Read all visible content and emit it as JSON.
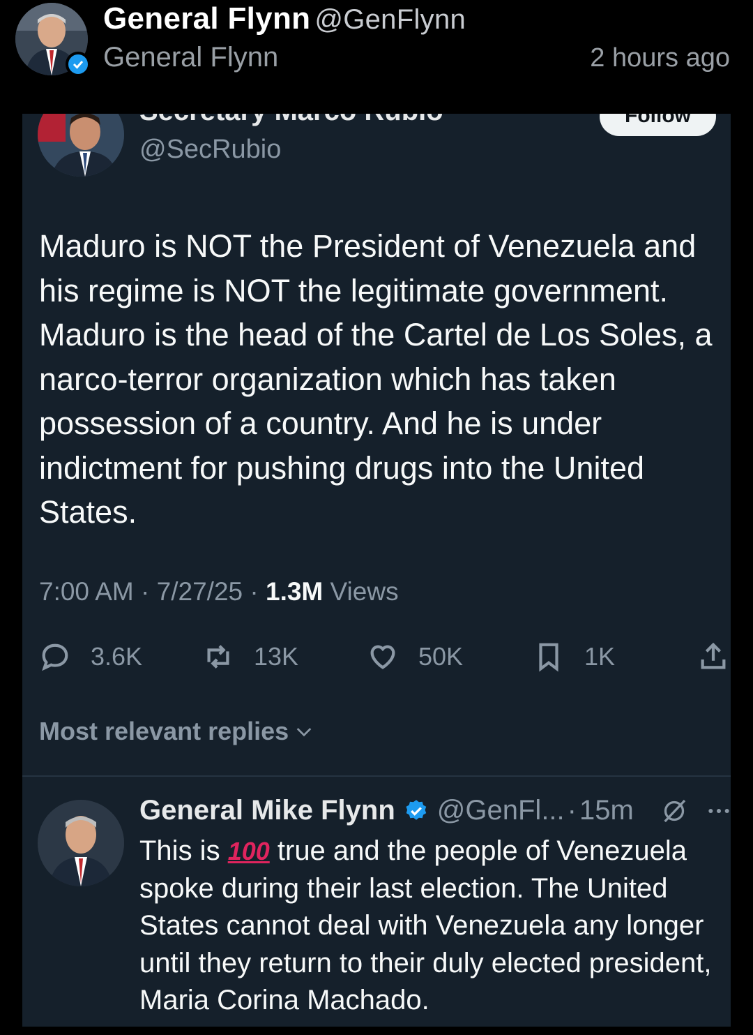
{
  "post": {
    "author_name": "General Flynn",
    "author_handle": "@GenFlynn",
    "author_subtitle": "General Flynn",
    "time_ago": "2 hours ago"
  },
  "embedded_tweet": {
    "author_name_partial": "Secretary Marco Rubio",
    "follow_label": "Follow",
    "author_handle": "@SecRubio",
    "body": "Maduro is NOT the President of Venezuela and\nhis regime is NOT the legitimate government.\nMaduro is the head of the Cartel de Los Soles, a\nnarco-terror organization which has taken\npossession of a country.  And he is under\nindictment for pushing drugs into the United\nStates.",
    "time": "7:00 AM",
    "date": "7/27/25",
    "views_count": "1.3M",
    "views_label": "Views",
    "replies": "3.6K",
    "reposts": "13K",
    "likes": "50K",
    "bookmarks": "1K",
    "replies_sort_label": "Most relevant replies"
  },
  "reply": {
    "author_name": "General Mike Flynn",
    "author_handle": "@GenFl...",
    "time": "15m",
    "body_before": "This is ",
    "emoji_100": "100",
    "body_after": " true and the people of Venezuela spoke during their last election. The United States cannot deal with Venezuela any longer until they return to their duly elected president, Maria Corina Machado."
  },
  "colors": {
    "background": "#000000",
    "card": "#15202b",
    "verified": "#1d9bf0",
    "muted": "#8b98a5"
  }
}
